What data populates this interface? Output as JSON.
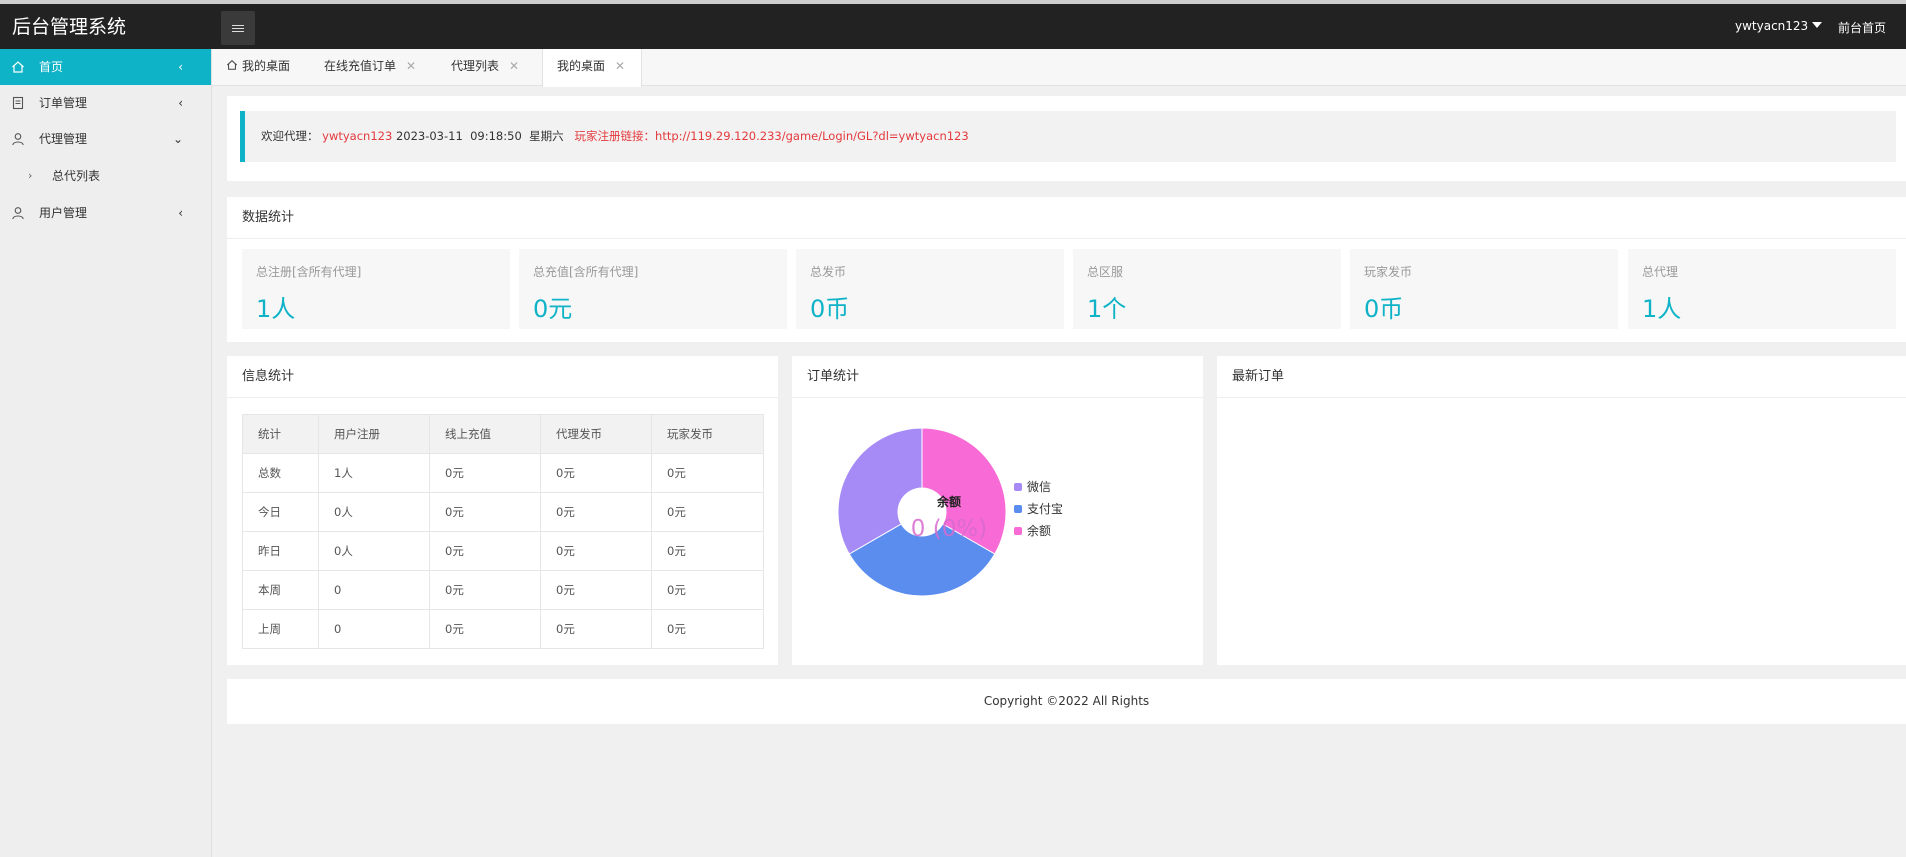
{
  "header": {
    "brand": "后台管理系统",
    "user_name": "ywtyacn123",
    "front_link": "前台首页"
  },
  "sidebar": {
    "items": [
      {
        "label": "首页",
        "icon": "home-icon",
        "arrow": "‹"
      },
      {
        "label": "订单管理",
        "icon": "document-icon",
        "arrow": "‹"
      },
      {
        "label": "代理管理",
        "icon": "user-icon",
        "arrow": "⌄"
      },
      {
        "label": "用户管理",
        "icon": "user-icon",
        "arrow": "‹"
      }
    ],
    "sub_items": [
      {
        "label": "总代列表"
      }
    ]
  },
  "tabs": [
    {
      "label": "我的桌面",
      "icon": "home-icon"
    },
    {
      "label": "在线充值订单",
      "close": "✕"
    },
    {
      "label": "代理列表",
      "close": "✕"
    },
    {
      "label": "我的桌面",
      "close": "✕"
    }
  ],
  "welcome": {
    "prefix": "欢迎代理：",
    "user": "ywtyacn123",
    "date": "2023-03-11",
    "time": "09:18:50",
    "weekday": "星期六",
    "link_label": "玩家注册链接：",
    "link_url": "http://119.29.120.233/game/Login/GL?dl=ywtyacn123"
  },
  "data_stats": {
    "title": "数据统计",
    "boxes": [
      {
        "label": "总注册[含所有代理]",
        "value": "1人"
      },
      {
        "label": "总充值[含所有代理]",
        "value": "0元"
      },
      {
        "label": "总发币",
        "value": "0币"
      },
      {
        "label": "总区服",
        "value": "1个"
      },
      {
        "label": "玩家发币",
        "value": "0币"
      },
      {
        "label": "总代理",
        "value": "1人"
      }
    ]
  },
  "info_stats": {
    "title": "信息统计",
    "columns": [
      "统计",
      "用户注册",
      "线上充值",
      "代理发币",
      "玩家发币"
    ],
    "rows": [
      [
        "总数",
        "1人",
        "0元",
        "0元",
        "0元"
      ],
      [
        "今日",
        "0人",
        "0元",
        "0元",
        "0元"
      ],
      [
        "昨日",
        "0人",
        "0元",
        "0元",
        "0元"
      ],
      [
        "本周",
        "0",
        "0元",
        "0元",
        "0元"
      ],
      [
        "上周",
        "0",
        "0元",
        "0元",
        "0元"
      ]
    ]
  },
  "order_stats": {
    "title": "订单统计",
    "center_label": "余额",
    "center_value": "0 (0%)"
  },
  "latest_orders": {
    "title": "最新订单"
  },
  "chart_data": {
    "type": "pie",
    "title": "",
    "categories": [
      "微信",
      "支付宝",
      "余额"
    ],
    "values": [
      0,
      0,
      0
    ],
    "colors": [
      "#a68bf7",
      "#5b8def",
      "#f86bd6"
    ],
    "legend_position": "right"
  },
  "footer": {
    "copyright": "Copyright ©2022 All Rights"
  }
}
